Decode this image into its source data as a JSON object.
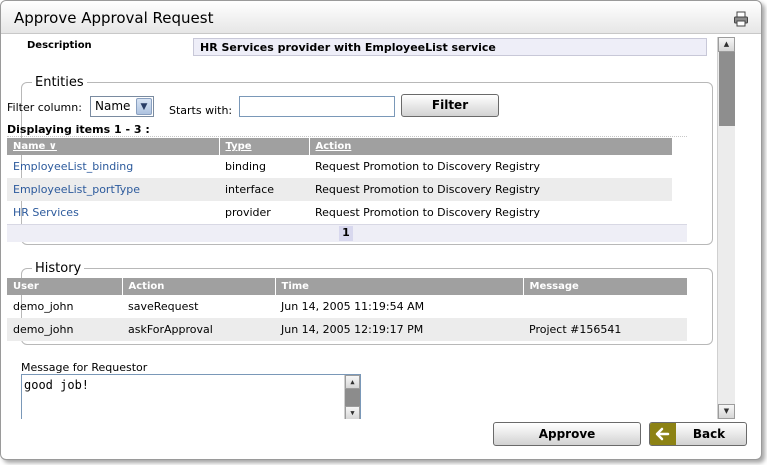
{
  "window": {
    "title": "Approve Approval Request"
  },
  "description": {
    "label": "Description",
    "value": "HR Services provider with EmployeeList service"
  },
  "entities": {
    "legend": "Entities",
    "filter_column_label": "Filter column:",
    "filter_column_value": "Name",
    "starts_with_label": "Starts with:",
    "starts_with_value": "",
    "filter_button": "Filter",
    "displaying": "Displaying items 1 - 3 :",
    "columns": [
      "Name ∨",
      "Type",
      "Action"
    ],
    "rows": [
      {
        "name": "EmployeeList_binding",
        "type": "binding",
        "action": "Request Promotion to Discovery Registry"
      },
      {
        "name": "EmployeeList_portType",
        "type": "interface",
        "action": "Request Promotion to Discovery Registry"
      },
      {
        "name": "HR Services",
        "type": "provider",
        "action": "Request Promotion to Discovery Registry"
      }
    ],
    "page": "1"
  },
  "history": {
    "legend": "History",
    "columns": [
      "User",
      "Action",
      "Time",
      "Message"
    ],
    "rows": [
      {
        "user": "demo_john",
        "action": "saveRequest",
        "time": "Jun 14, 2005 11:19:54 AM",
        "message": ""
      },
      {
        "user": "demo_john",
        "action": "askForApproval",
        "time": "Jun 14, 2005 12:19:17 PM",
        "message": "Project #156541"
      }
    ]
  },
  "message": {
    "label": "Message for Requestor",
    "value": "good job!"
  },
  "buttons": {
    "approve": "Approve",
    "back": "Back"
  },
  "colors": {
    "header_gray": "#a0a0a0",
    "link_blue": "#2c5a9c",
    "back_icon": "#8c8214"
  },
  "icons": {
    "print": "printer-icon",
    "back": "back-arrow-icon"
  }
}
